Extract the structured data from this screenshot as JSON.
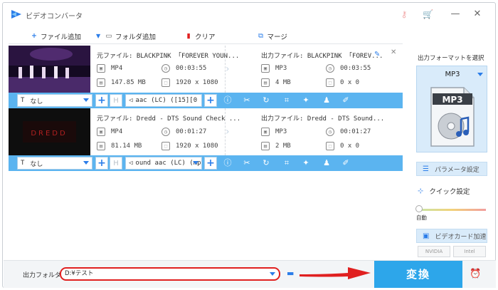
{
  "app": {
    "title": "ビデオコンバータ"
  },
  "toolbar": {
    "add_file": "ファイル追加",
    "add_folder": "フォルダ追加",
    "clear": "クリア",
    "merge": "マージ"
  },
  "files": [
    {
      "source": "元ファイル: BLACKPINK 「FOREVER YOUN...",
      "source_format": "MP4",
      "source_duration": "00:03:55",
      "source_size": "147.85 MB",
      "source_resolution": "1920 x 1080",
      "output": "出力ファイル: BLACKPINK 「FOREV...",
      "output_format": "MP3",
      "output_duration": "00:03:55",
      "output_size": "4 MB",
      "output_resolution": "0 x 0",
      "subtitle": "なし",
      "audio": "aac (LC) ([15][0"
    },
    {
      "source": "元ファイル: Dredd - DTS Sound Check ...",
      "source_format": "MP4",
      "source_duration": "00:01:27",
      "source_size": "81.14 MB",
      "source_resolution": "1920 x 1080",
      "output": "出力ファイル: Dredd - DTS Sound...",
      "output_format": "MP3",
      "output_duration": "00:01:27",
      "output_size": "2 MB",
      "output_resolution": "0 x 0",
      "subtitle": "なし",
      "audio": "ound aac (LC) (mp"
    }
  ],
  "right_panel": {
    "title": "出力フォーマットを選択",
    "format": "MP3",
    "format_badge": "MP3",
    "params": "パラメータ設定",
    "quick": "クイック設定",
    "speed_label": "自動",
    "gpu": "ビデオカード加速",
    "nvidia": "NVIDIA",
    "intel": "Intel"
  },
  "bottom": {
    "output_label": "出力フォルダ:",
    "output_path": "D:¥テスト",
    "convert": "変換"
  },
  "colors": {
    "accent": "#2da6ea",
    "option_bar": "#5bb4f0",
    "highlight_red": "#e02020"
  }
}
